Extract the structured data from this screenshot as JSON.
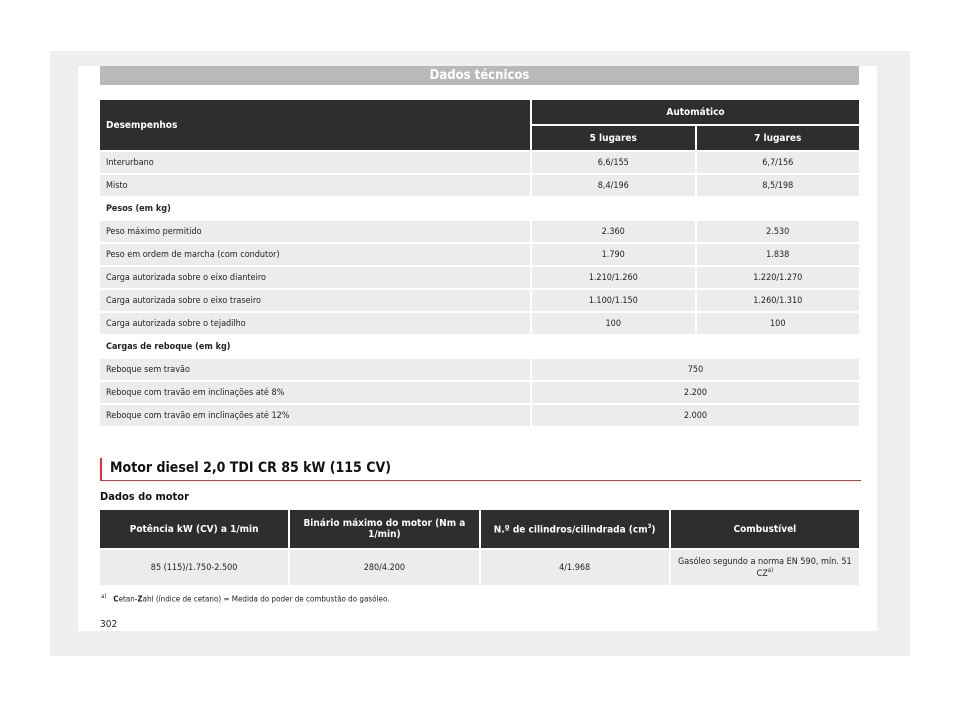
{
  "page_header": "Dados técnicos",
  "table1": {
    "col_header": "Desempenhos",
    "group_header": "Automático",
    "sub_headers": [
      "5 lugares",
      "7 lugares"
    ],
    "rows": [
      {
        "label": "Interurbano",
        "v1": "6,6/155",
        "v2": "6,7/156"
      },
      {
        "label": "Misto",
        "v1": "8,4/196",
        "v2": "8,5/198"
      }
    ],
    "section_pesos": "Pesos (em kg)",
    "pesos_rows": [
      {
        "label": "Peso máximo permitido",
        "v1": "2.360",
        "v2": "2.530"
      },
      {
        "label": "Peso em ordem de marcha (com condutor)",
        "v1": "1.790",
        "v2": "1.838"
      },
      {
        "label": "Carga autorizada sobre o eixo dianteiro",
        "v1": "1.210/1.260",
        "v2": "1.220/1.270"
      },
      {
        "label": "Carga autorizada sobre o eixo traseiro",
        "v1": "1.100/1.150",
        "v2": "1.260/1.310"
      },
      {
        "label": "Carga autorizada sobre o tejadilho",
        "v1": "100",
        "v2": "100"
      }
    ],
    "section_reboque": "Cargas de reboque (em kg)",
    "reboque_rows": [
      {
        "label": "Reboque sem travão",
        "v": "750"
      },
      {
        "label": "Reboque com travão em inclinações até 8%",
        "v": "2.200"
      },
      {
        "label": "Reboque com travão em inclinações até 12%",
        "v": "2.000"
      }
    ]
  },
  "section_title": "Motor diesel 2,0 TDI CR 85 kW (115 CV)",
  "subtitle": "Dados do motor",
  "table2": {
    "headers": {
      "power": "Potência kW (CV) a 1/min",
      "torque": "Binário máximo do motor (Nm a 1/min)",
      "cyl": "N.º de cilindros/cilindrada (cm",
      "cyl_sup": "3",
      "cyl_end": ")",
      "fuel": "Combustível"
    },
    "row": {
      "power": "85 (115)/1.750-2.500",
      "torque": "280/4.200",
      "cyl": "4/1.968",
      "fuel": "Gasóleo segundo a norma EN 590, mín. 51 CZ",
      "fuel_sup": "a)"
    }
  },
  "footnote": {
    "marker": "a)",
    "c_bold": "C",
    "etan": "etan-",
    "z_bold": "Z",
    "rest": "ahl (índice de cetano) = Medida do poder de combustão do gasóleo."
  },
  "page_number": "302"
}
